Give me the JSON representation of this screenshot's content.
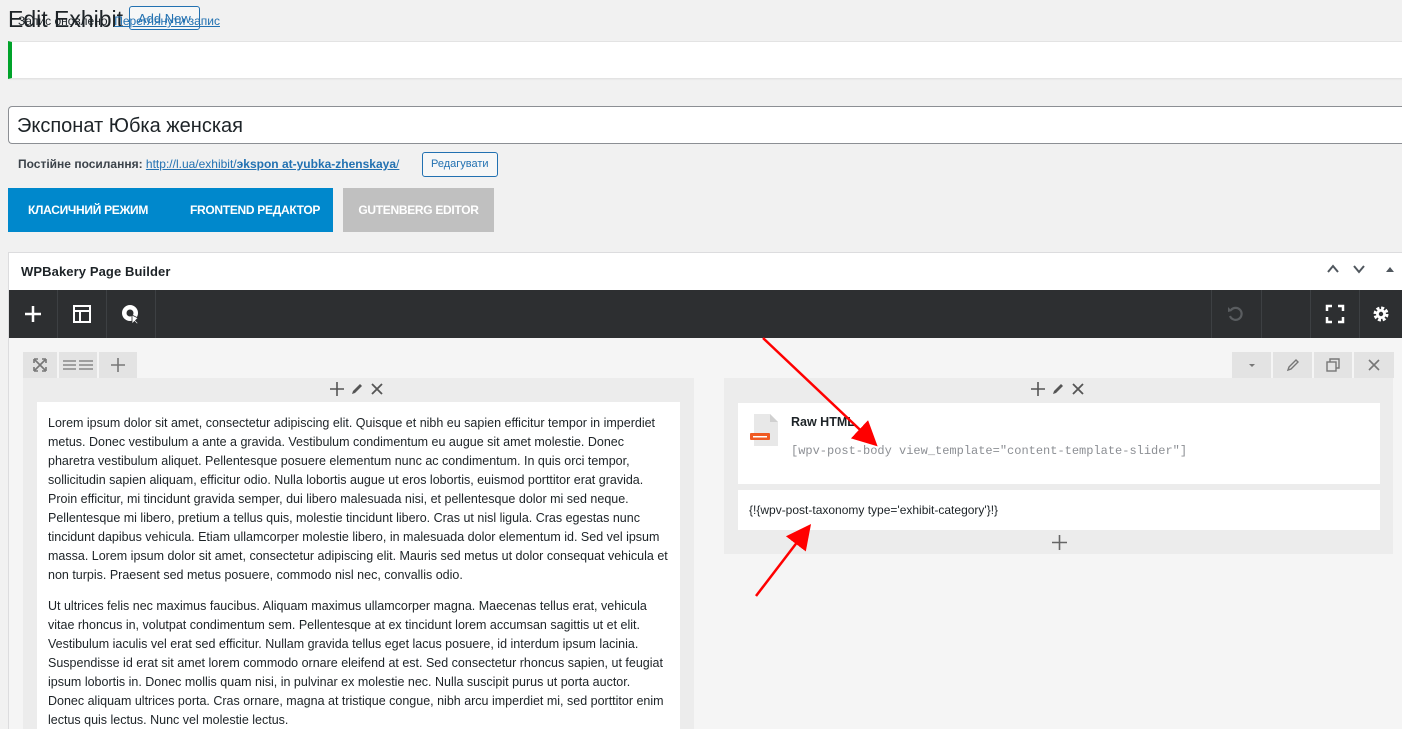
{
  "header": {
    "title": "Edit Exhibit",
    "add_new": "Add New"
  },
  "notice": {
    "text": "Запис оновлено.",
    "link": "Переглянути запис"
  },
  "post": {
    "title": "Экспонат Юбка женская",
    "permalink_label": "Постійне посилання:",
    "permalink_url": "http://l.ua/exhibit/эkspon at-yubka-zhenskaya/",
    "edit_button": "Редагувати"
  },
  "modes": {
    "classic": "Класичний режим",
    "frontend": "Frontend редактор",
    "gutenberg": "GUTENBERG EDITOR"
  },
  "builder": {
    "title": "WPBakery Page Builder",
    "toolbar": {
      "add": "add-element",
      "templates": "templates",
      "grid": "grid-builder",
      "undo": "undo",
      "fullscreen": "fullscreen",
      "settings": "settings"
    }
  },
  "left_column": {
    "paragraphs": [
      "Lorem ipsum dolor sit amet, consectetur adipiscing elit. Quisque et nibh eu sapien efficitur tempor in imperdiet metus. Donec vestibulum a ante a gravida. Vestibulum condimentum eu augue sit amet molestie. Donec pharetra vestibulum aliquet. Pellentesque posuere elementum nunc ac condimentum. In quis orci tempor, sollicitudin sapien aliquam, efficitur odio. Nulla lobortis augue ut eros lobortis, euismod porttitor erat gravida. Proin efficitur, mi tincidunt gravida semper, dui libero malesuada nisi, et pellentesque dolor mi sed neque. Pellentesque mi libero, pretium a tellus quis, molestie tincidunt libero. Cras ut nisl ligula. Cras egestas nunc tincidunt dapibus vehicula. Etiam ullamcorper molestie libero, in malesuada dolor elementum id. Sed vel ipsum massa. Lorem ipsum dolor sit amet, consectetur adipiscing elit. Mauris sed metus ut dolor consequat vehicula et non turpis. Praesent sed metus posuere, commodo nisl nec, convallis odio.",
      "Ut ultrices felis nec maximus faucibus. Aliquam maximus ullamcorper magna. Maecenas tellus erat, vehicula vitae rhoncus in, volutpat condimentum sem. Pellentesque at ex tincidunt lorem accumsan sagittis ut et elit. Vestibulum iaculis vel erat sed efficitur. Nullam gravida tellus eget lacus posuere, id interdum ipsum lacinia. Suspendisse id erat sit amet lorem commodo ornare eleifend at est. Sed consectetur rhoncus sapien, ut feugiat ipsum lobortis in. Donec mollis quam nisi, in pulvinar ex molestie nec. Nulla suscipit purus ut porta auctor. Donec aliquam ultrices porta. Cras ornare, magna at tristique congue, nibh arcu imperdiet mi, sed porttitor enim lectus quis lectus. Nunc vel molestie lectus."
    ]
  },
  "right_column": {
    "raw_html_title": "Raw HTML",
    "raw_html_code": "[wpv-post-body view_template=\"content-template-slider\"]",
    "taxonomy_text": "{!{wpv-post-taxonomy type='exhibit-category'}!}"
  },
  "colors": {
    "accent": "#0088cc",
    "toolbar": "#2d2f31",
    "notice_success": "#00a32a",
    "annotation_arrow": "#ff0000"
  }
}
